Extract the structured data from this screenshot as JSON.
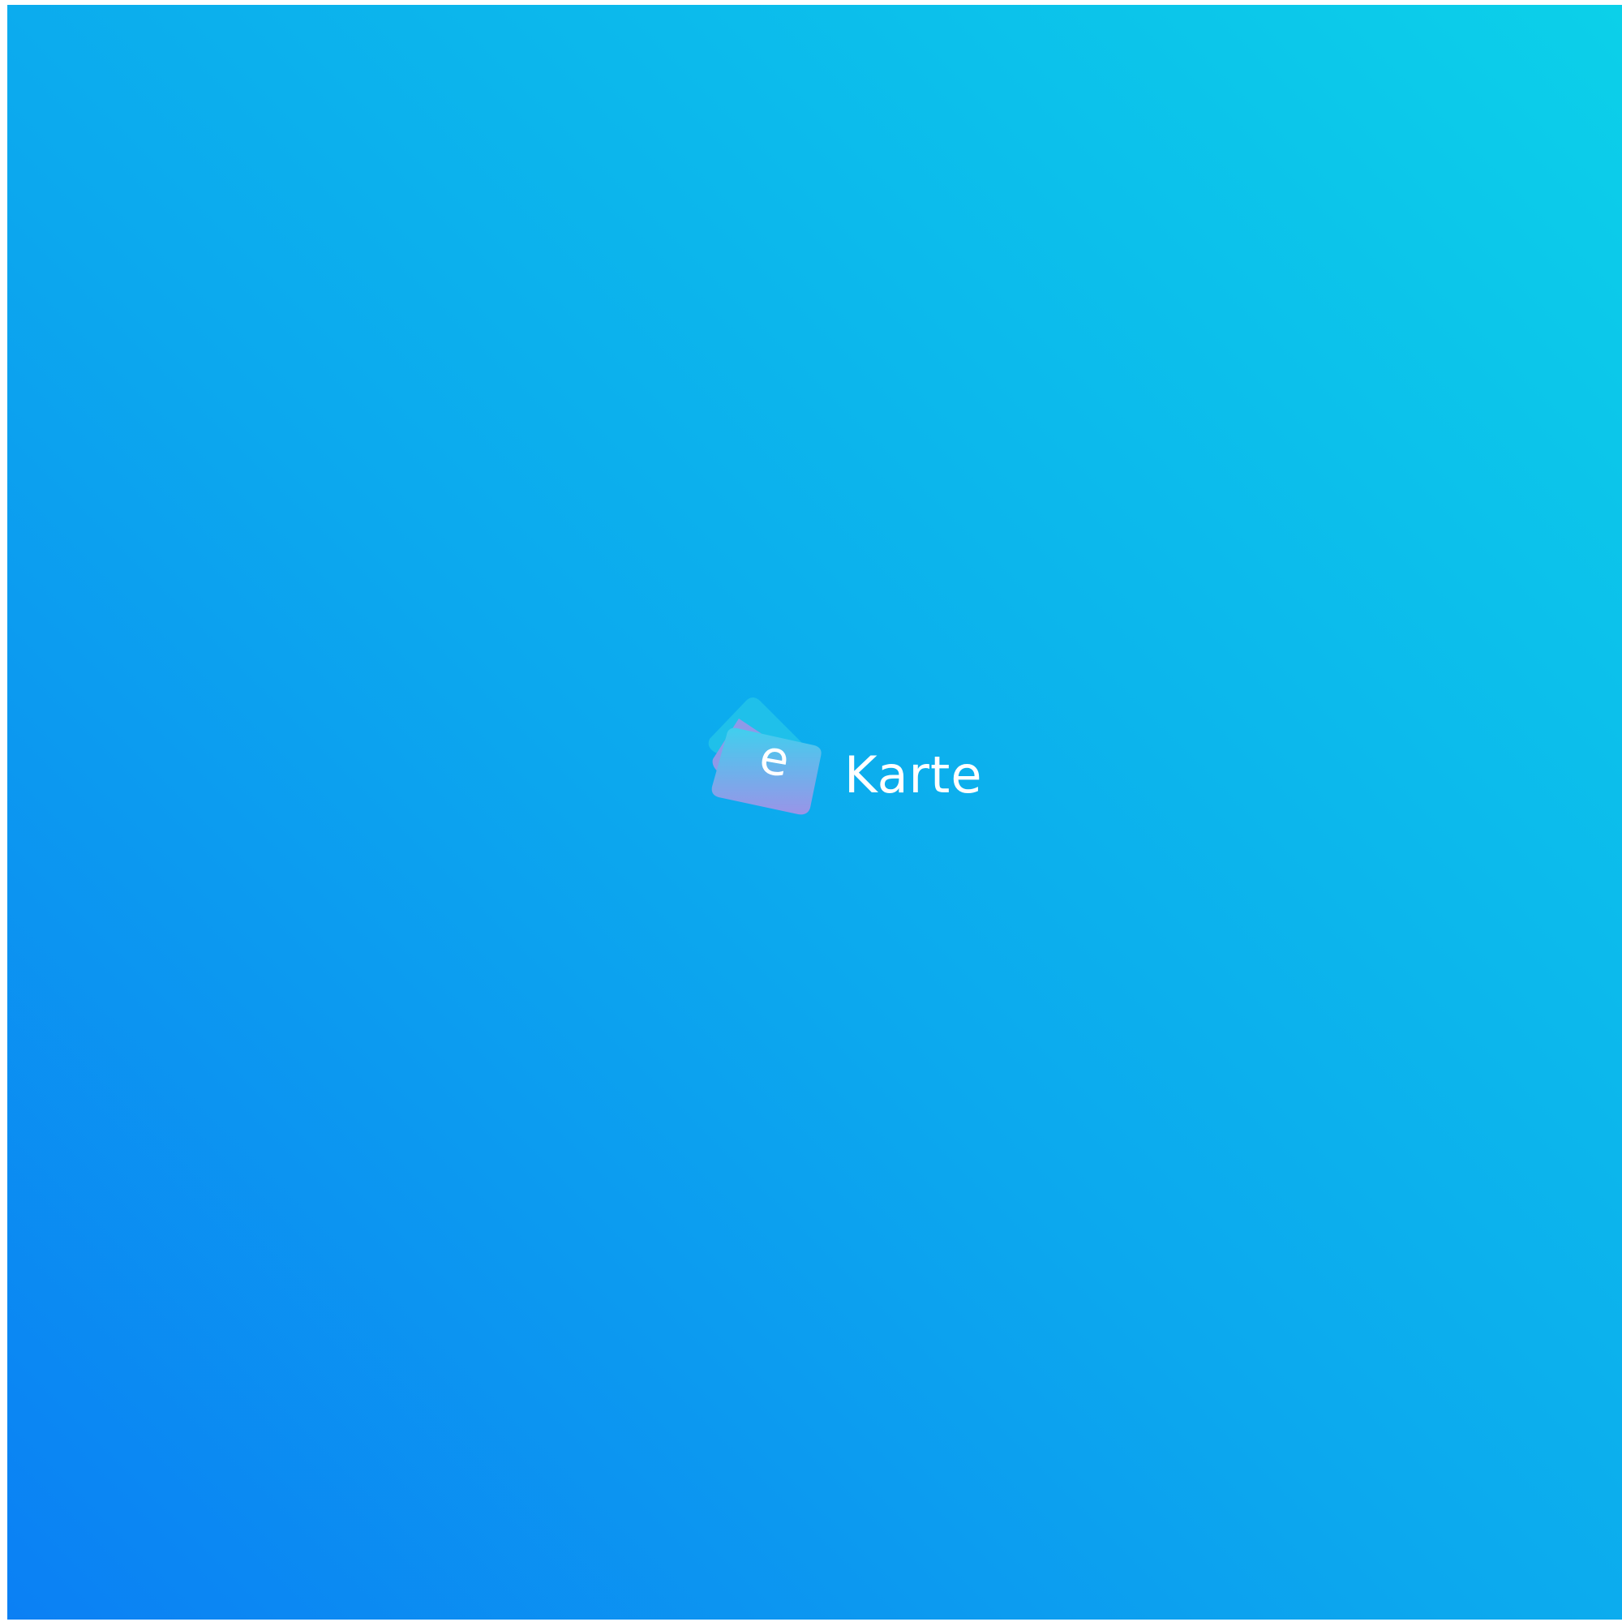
{
  "splash": {
    "background_gradient": [
      "#0b80f4",
      "#0ca8ee",
      "#0cd0e9"
    ]
  },
  "logo": {
    "letter": "e",
    "wordmark": "Karte",
    "icon": "stacked-cards-icon",
    "card_colors": [
      "#1fc0ea",
      "#8f99e8",
      "#40cfee"
    ]
  }
}
